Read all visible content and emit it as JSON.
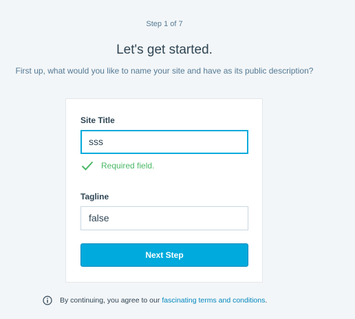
{
  "step_indicator": "Step 1 of 7",
  "heading": "Let's get started.",
  "subheading": "First up, what would you like to name your site and have as its public description?",
  "form": {
    "site_title_label": "Site Title",
    "site_title_value": "sss",
    "site_title_validation": "Required field.",
    "tagline_label": "Tagline",
    "tagline_value": "false",
    "submit_label": "Next Step"
  },
  "footer": {
    "terms_prefix": "By continuing, you agree to our",
    "terms_link": "fascinating terms and conditions",
    "terms_suffix": "."
  },
  "icons": {
    "validation": "checkmark-icon",
    "terms": "info-icon"
  },
  "colors": {
    "accent": "#00aadc",
    "success": "#4ab866",
    "link": "#0087be",
    "text": "#2e4453",
    "muted": "#537994"
  }
}
